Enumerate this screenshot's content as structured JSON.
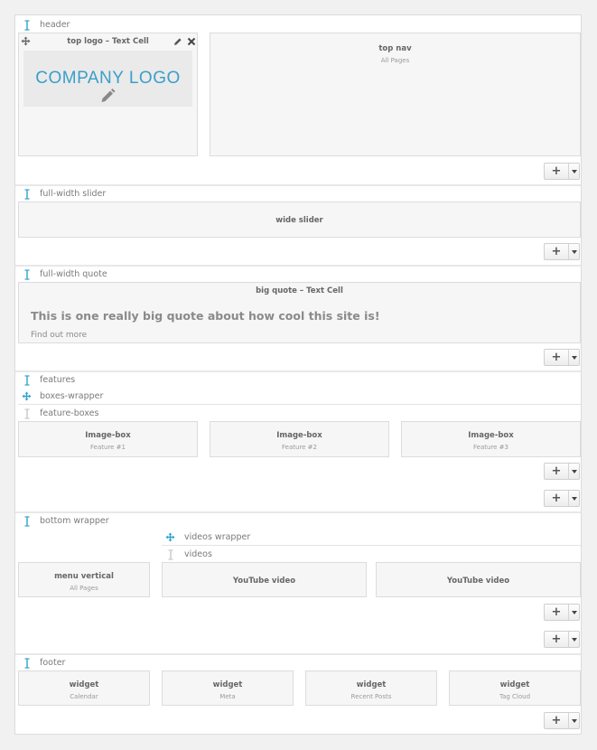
{
  "rows": {
    "header": "header",
    "slider": "full-width slider",
    "quote": "full-width quote",
    "features": "features",
    "boxes_wrapper": "boxes-wrapper",
    "feature_boxes": "feature-boxes",
    "bottom_wrapper": "bottom wrapper",
    "videos_wrapper": "videos wrapper",
    "videos": "videos",
    "footer": "footer"
  },
  "logo_cell": {
    "title": "top logo – Text Cell",
    "logo_text": "COMPANY LOGO"
  },
  "top_nav": {
    "title": "top nav",
    "sub": "All Pages"
  },
  "wide_slider": {
    "title": "wide slider"
  },
  "quote_cell": {
    "title": "big quote – Text Cell",
    "quote": "This is one really big quote about how cool this site is!",
    "link": "Find out more"
  },
  "feature_cells": [
    {
      "title": "Image-box",
      "sub": "Feature #1"
    },
    {
      "title": "Image-box",
      "sub": "Feature #2"
    },
    {
      "title": "Image-box",
      "sub": "Feature #3"
    }
  ],
  "menu_cell": {
    "title": "menu vertical",
    "sub": "All Pages"
  },
  "video_cells": [
    {
      "title": "YouTube video"
    },
    {
      "title": "YouTube video"
    }
  ],
  "footer_cells": [
    {
      "title": "widget",
      "sub": "Calendar"
    },
    {
      "title": "widget",
      "sub": "Meta"
    },
    {
      "title": "widget",
      "sub": "Recent Posts"
    },
    {
      "title": "widget",
      "sub": "Tag Cloud"
    }
  ],
  "add_button": {
    "plus": "+"
  },
  "colors": {
    "accent": "#2ea2cc",
    "cell_bg": "#f6f6f6",
    "border": "#dcdcdc"
  },
  "icons": [
    "row-drag-icon",
    "move-icon",
    "edit-icon",
    "close-icon",
    "pencil-icon",
    "plus-icon",
    "caret-down-icon"
  ]
}
